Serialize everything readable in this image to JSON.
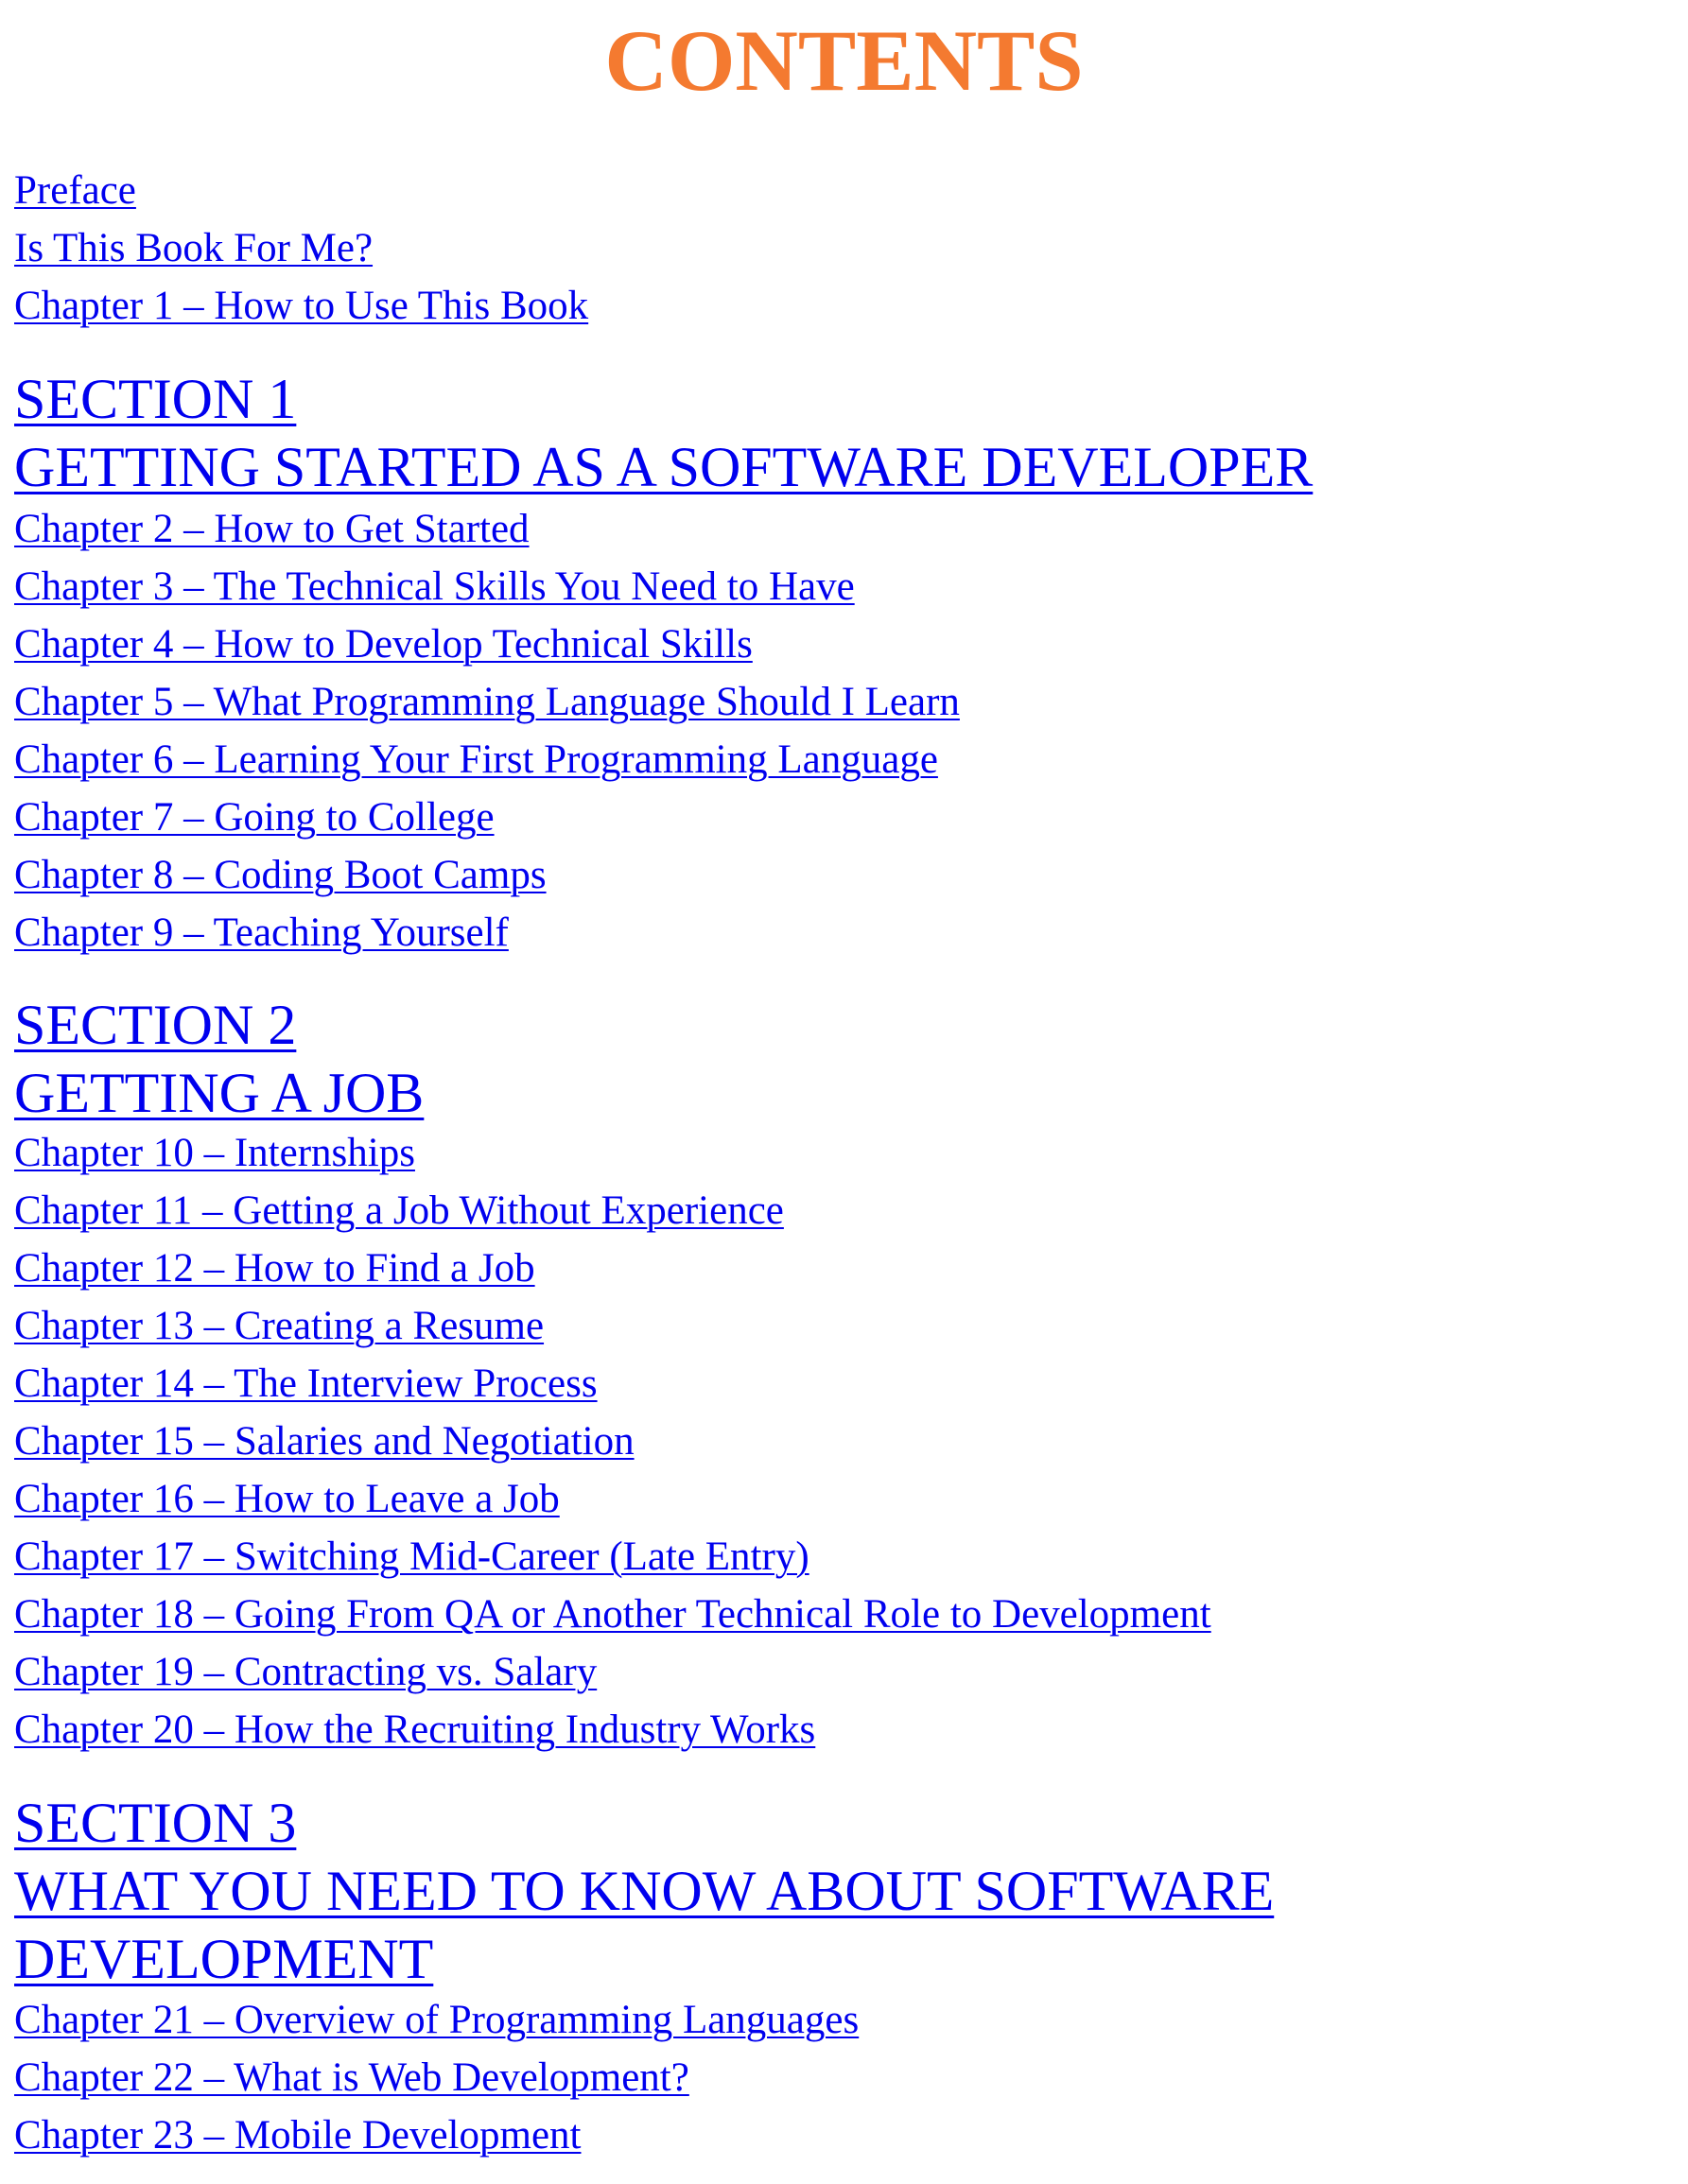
{
  "title": "CONTENTS",
  "colors": {
    "title": "#F47A30",
    "link": "#0000EE"
  },
  "front_matter": [
    "Preface",
    "Is This Book For Me?",
    "Chapter 1 – How to Use This Book"
  ],
  "sections": [
    {
      "number_label": "SECTION 1",
      "title_lines": [
        "GETTING STARTED AS A SOFTWARE DEVELOPER"
      ],
      "chapters": [
        "Chapter 2 – How to Get Started",
        "Chapter 3 – The Technical Skills You Need to Have",
        "Chapter 4 – How to Develop Technical Skills",
        "Chapter 5 – What Programming Language Should I Learn",
        "Chapter 6 – Learning Your First Programming Language",
        "Chapter 7 – Going to College",
        "Chapter 8 – Coding Boot Camps",
        "Chapter 9 – Teaching Yourself"
      ]
    },
    {
      "number_label": "SECTION 2",
      "title_lines": [
        "GETTING A JOB"
      ],
      "chapters": [
        "Chapter 10 – Internships",
        "Chapter 11 – Getting a Job Without Experience",
        "Chapter 12 – How to Find a Job",
        "Chapter 13 – Creating a Resume",
        "Chapter 14 – The Interview Process",
        "Chapter 15 – Salaries and Negotiation",
        "Chapter 16 – How to Leave a Job",
        "Chapter 17 – Switching Mid-Career (Late Entry)",
        "Chapter 18 – Going From QA or Another Technical Role to Development",
        "Chapter 19 – Contracting vs. Salary",
        "Chapter 20 – How the Recruiting Industry Works"
      ]
    },
    {
      "number_label": "SECTION 3",
      "title_lines": [
        "WHAT YOU NEED TO KNOW ABOUT SOFTWARE",
        "DEVELOPMENT"
      ],
      "chapters": [
        "Chapter 21 – Overview of Programming Languages",
        "Chapter 22 – What is Web Development?",
        "Chapter 23 – Mobile Development"
      ]
    }
  ]
}
